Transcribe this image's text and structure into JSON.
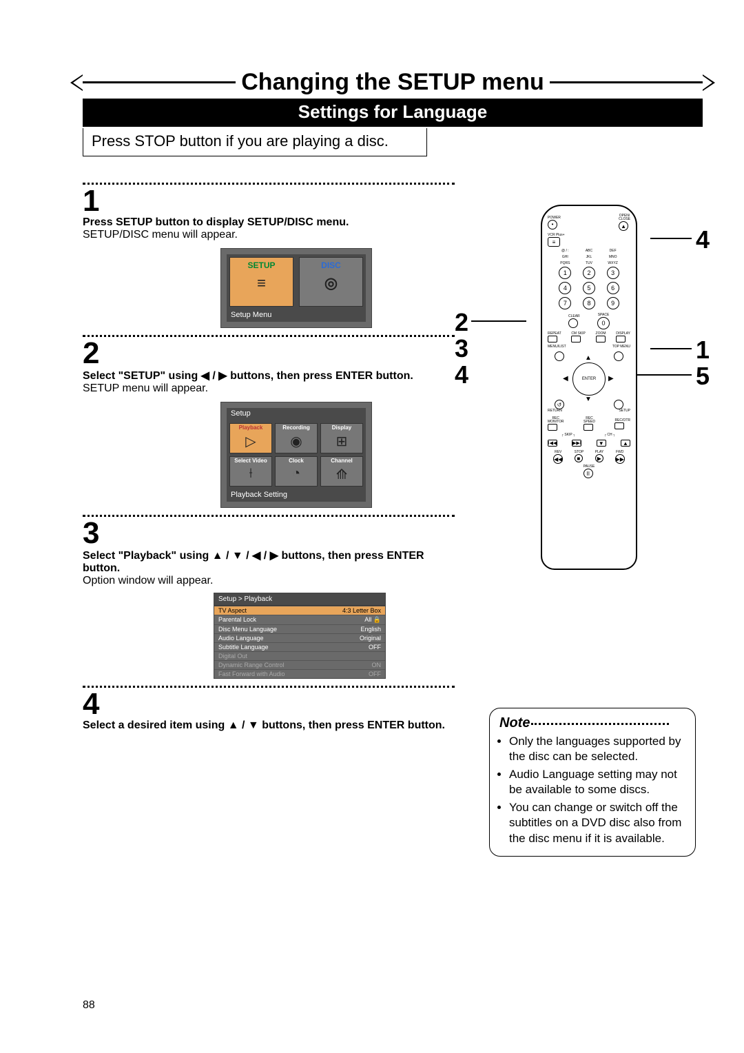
{
  "title": "Changing the SETUP menu",
  "section_bar": "Settings for Language",
  "press_stop": "Press STOP button if you are playing a disc.",
  "page_number": "88",
  "steps": {
    "s1": {
      "num": "1",
      "bold": "Press SETUP button to display SETUP/DISC menu.",
      "plain": "SETUP/DISC menu will appear."
    },
    "s2": {
      "num": "2",
      "bold_a": "Select \"SETUP\" using ",
      "bold_b": " buttons, then press ENTER button.",
      "arrows": "◀ / ▶",
      "plain": "SETUP menu will appear."
    },
    "s3": {
      "num": "3",
      "bold_a": "Select \"Playback\" using ",
      "bold_b": " buttons, then press ENTER button.",
      "arrows": "▲ / ▼ / ◀ / ▶",
      "plain": "Option window will appear."
    },
    "s4": {
      "num": "4",
      "bold_a": "Select a desired item using ",
      "bold_b": " buttons, then press ENTER button.",
      "arrows": "▲ / ▼"
    }
  },
  "screen1": {
    "tab_setup": "SETUP",
    "tab_disc": "DISC",
    "caption": "Setup Menu"
  },
  "screen2": {
    "title": "Setup",
    "caption": "Playback Setting",
    "cells": [
      "Playback",
      "Recording",
      "Display",
      "Select Video",
      "Clock",
      "Channel"
    ],
    "icons": [
      "▷",
      "◉",
      "⊞",
      "⟊",
      "◔",
      "⟰"
    ]
  },
  "screen3": {
    "title": "Setup > Playback",
    "rows": [
      {
        "k": "TV Aspect",
        "v": "4:3 Letter Box"
      },
      {
        "k": "Parental Lock",
        "v": "All  🔒"
      },
      {
        "k": "Disc Menu Language",
        "v": "English"
      },
      {
        "k": "Audio Language",
        "v": "Original"
      },
      {
        "k": "Subtitle Language",
        "v": "OFF"
      },
      {
        "k": "Digital Out",
        "v": ""
      },
      {
        "k": "Dynamic Range Control",
        "v": "ON"
      },
      {
        "k": "Fast Forward with Audio",
        "v": "OFF"
      }
    ]
  },
  "remote": {
    "labels": {
      "power": "POWER",
      "open_close": "OPEN/\nCLOSE",
      "vcr": "VCR Plus+",
      "clear": "CLEAR",
      "space": "SPACE",
      "repeat": "REPEAT",
      "cm_skip": "CM SKIP",
      "zoom": "ZOOM",
      "display": "DISPLAY",
      "menu_list": "MENU/LIST",
      "top_menu": "TOP MENU",
      "enter": "ENTER",
      "return": "RETURN",
      "setup": "SETUP",
      "rec_monitor": "REC\nMONITOR",
      "rec_speed": "REC\nSPEED",
      "rec_otr": "REC/OTR",
      "skip": "SKIP",
      "ch": "CH",
      "rev": "REV",
      "stop": "STOP",
      "play": "PLAY",
      "fwd": "FWD",
      "pause": "PAUSE"
    },
    "num_labels": [
      "@ / :",
      "ABC",
      "DEF",
      "GHI",
      "JKL",
      "MNO",
      "PQRS",
      "TUV",
      "WXYZ"
    ],
    "nums": [
      "1",
      "2",
      "3",
      "4",
      "5",
      "6",
      "7",
      "8",
      "9"
    ],
    "zero": "0"
  },
  "callouts": {
    "left_top": "2",
    "left_mid": "3",
    "left_bot": "4",
    "right_top": "4",
    "right_mid": "1",
    "right_bot": "5"
  },
  "note": {
    "title": "Note",
    "items": [
      "Only the languages supported by the disc can be selected.",
      "Audio Language setting may not be available to some discs.",
      "You can change or switch off the subtitles on a DVD disc also from the disc menu if it is available."
    ]
  }
}
